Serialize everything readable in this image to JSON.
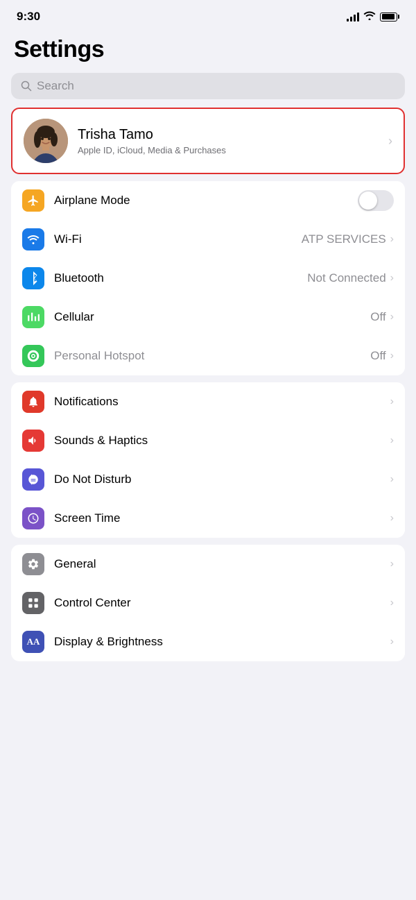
{
  "statusBar": {
    "time": "9:30",
    "signal": "signal",
    "wifi": "wifi",
    "battery": "battery"
  },
  "page": {
    "title": "Settings"
  },
  "search": {
    "placeholder": "Search"
  },
  "profile": {
    "name": "Trisha Tamo",
    "subtitle": "Apple ID, iCloud, Media & Purchases",
    "chevron": "›"
  },
  "groups": [
    {
      "id": "network",
      "rows": [
        {
          "id": "airplane",
          "label": "Airplane Mode",
          "value": "",
          "hasToggle": true,
          "toggleOn": false,
          "iconClass": "icon-orange",
          "iconSymbol": "✈"
        },
        {
          "id": "wifi",
          "label": "Wi-Fi",
          "value": "ATP SERVICES",
          "hasToggle": false,
          "iconClass": "icon-blue",
          "iconSymbol": "wifi"
        },
        {
          "id": "bluetooth",
          "label": "Bluetooth",
          "value": "Not Connected",
          "hasToggle": false,
          "iconClass": "icon-blue-mid",
          "iconSymbol": "bt"
        },
        {
          "id": "cellular",
          "label": "Cellular",
          "value": "Off",
          "hasToggle": false,
          "iconClass": "icon-green",
          "iconSymbol": "cell"
        },
        {
          "id": "hotspot",
          "label": "Personal Hotspot",
          "value": "Off",
          "hasToggle": false,
          "iconClass": "icon-green3",
          "iconSymbol": "hotspot",
          "disabled": true
        }
      ]
    },
    {
      "id": "notifications",
      "rows": [
        {
          "id": "notifications",
          "label": "Notifications",
          "value": "",
          "hasToggle": false,
          "iconClass": "icon-red",
          "iconSymbol": "notif"
        },
        {
          "id": "sounds",
          "label": "Sounds & Haptics",
          "value": "",
          "hasToggle": false,
          "iconClass": "icon-red2",
          "iconSymbol": "sound"
        },
        {
          "id": "donotdisturb",
          "label": "Do Not Disturb",
          "value": "",
          "hasToggle": false,
          "iconClass": "icon-purple",
          "iconSymbol": "moon"
        },
        {
          "id": "screentime",
          "label": "Screen Time",
          "value": "",
          "hasToggle": false,
          "iconClass": "icon-purple2",
          "iconSymbol": "time"
        }
      ]
    },
    {
      "id": "system",
      "rows": [
        {
          "id": "general",
          "label": "General",
          "value": "",
          "hasToggle": false,
          "iconClass": "icon-gray",
          "iconSymbol": "gear"
        },
        {
          "id": "controlcenter",
          "label": "Control Center",
          "value": "",
          "hasToggle": false,
          "iconClass": "icon-gray2",
          "iconSymbol": "ctrl"
        },
        {
          "id": "displaybrightness",
          "label": "Display & Brightness",
          "value": "",
          "hasToggle": false,
          "iconClass": "icon-indigo",
          "iconSymbol": "AA"
        }
      ]
    }
  ],
  "chevron": "›"
}
